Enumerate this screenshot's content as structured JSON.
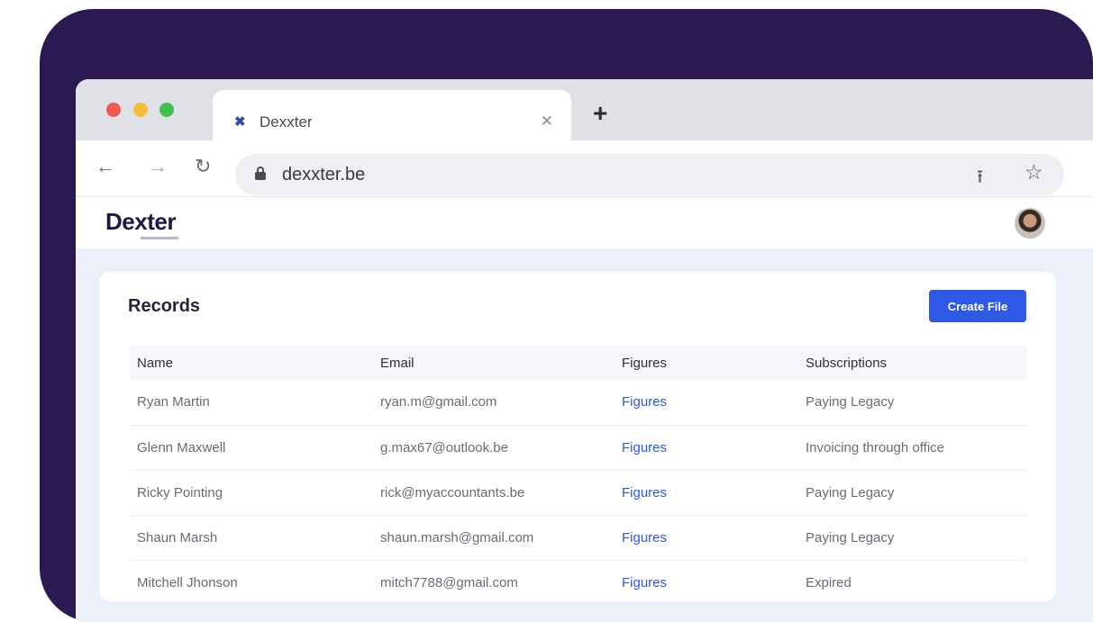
{
  "browser": {
    "tab": {
      "title": "Dexxter"
    },
    "url": "dexxter.be"
  },
  "app": {
    "logo": "Dexter",
    "records": {
      "title": "Records",
      "create_button": "Create File",
      "columns": [
        "Name",
        "Email",
        "Figures",
        "Subscriptions"
      ],
      "rows": [
        {
          "name": "Ryan Martin",
          "email": "ryan.m@gmail.com",
          "figures": "Figures",
          "subscription": "Paying Legacy"
        },
        {
          "name": "Glenn Maxwell",
          "email": "g.max67@outlook.be",
          "figures": "Figures",
          "subscription": "Invoicing through office"
        },
        {
          "name": "Ricky Pointing",
          "email": "rick@myaccountants.be",
          "figures": "Figures",
          "subscription": "Paying Legacy"
        },
        {
          "name": "Shaun Marsh",
          "email": "shaun.marsh@gmail.com",
          "figures": "Figures",
          "subscription": "Paying Legacy"
        },
        {
          "name": "Mitchell Jhonson",
          "email": "mitch7788@gmail.com",
          "figures": "Figures",
          "subscription": "Expired"
        }
      ]
    }
  },
  "colors": {
    "frame": "#2b1a52",
    "accent": "#2f59e6",
    "app_background": "#ecf0fb"
  }
}
